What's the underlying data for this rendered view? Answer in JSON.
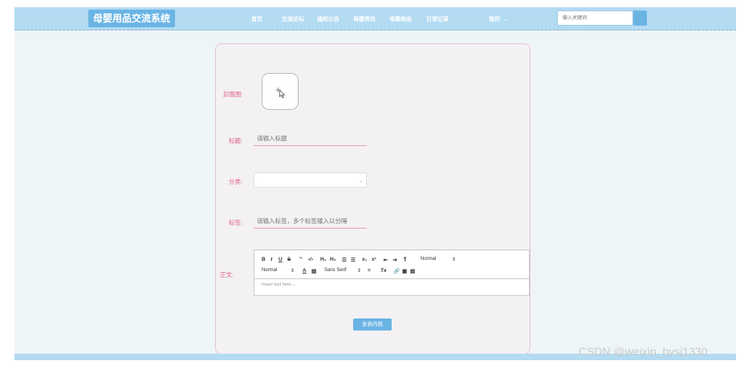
{
  "header": {
    "logo": "母婴用品交流系统",
    "nav": [
      {
        "label": "首页"
      },
      {
        "label": "交流论坛"
      },
      {
        "label": "通知公告"
      },
      {
        "label": "母婴资讯"
      },
      {
        "label": "母婴商品"
      },
      {
        "label": "日常记录"
      }
    ],
    "user_menu": "我的",
    "search_placeholder": "输入关键词"
  },
  "form": {
    "cover_label": "封面图:",
    "title_label": "标题:",
    "title_placeholder": "请输入标题",
    "category_label": "分类:",
    "category_value": "",
    "tags_label": "标签:",
    "tags_placeholder": "请输入标签，多个标签输入以分隔",
    "content_label": "正文:",
    "editor": {
      "header_select": "Normal",
      "size_select": "Normal",
      "font_select": "Sans Serif",
      "placeholder": "Insert text here ..."
    },
    "submit_label": "发表内容"
  },
  "watermark": "CSDN @weixin_bysj1330",
  "colors": {
    "topbar": "#b3dbf2",
    "accent": "#6ab4e4",
    "label": "#e05f84"
  }
}
